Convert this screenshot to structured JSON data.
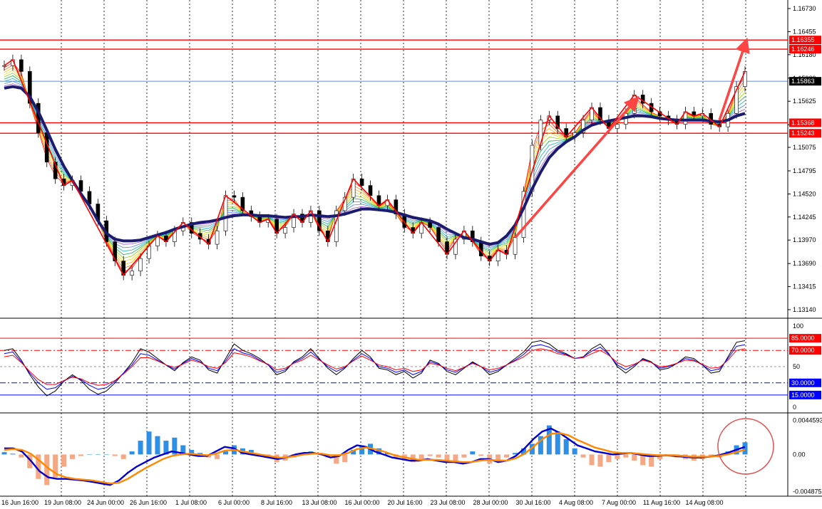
{
  "chart_data": [
    {
      "type": "line",
      "panel": "price",
      "y_ticks": [
        "1.16730",
        "1.16455",
        "1.16180",
        "1.15900",
        "1.15625",
        "1.15345",
        "1.15075",
        "1.14795",
        "1.14520",
        "1.14245",
        "1.13970",
        "1.13690",
        "1.13415",
        "1.13140"
      ],
      "ylim": [
        1.1314,
        1.1673
      ],
      "x_labels": [
        "16 Jun 16:00",
        "19 Jun 08:00",
        "24 Jun 00:00",
        "26 Jun 16:00",
        "1 Jul 08:00",
        "6 Jul 00:00",
        "8 Jul 16:00",
        "13 Jul 08:00",
        "16 Jul 00:00",
        "20 Jul 16:00",
        "23 Jul 08:00",
        "28 Jul 00:00",
        "30 Jul 16:00",
        "4 Aug 08:00",
        "7 Aug 00:00",
        "11 Aug 16:00",
        "14 Aug 08:00"
      ],
      "horizontal_levels": [
        {
          "value": 1.16355,
          "label": "1.16355",
          "color": "#ff0000"
        },
        {
          "value": 1.16246,
          "label": "1.16246",
          "color": "#ff0000"
        },
        {
          "value": 1.15863,
          "label": "1.15863",
          "color": "#000000"
        },
        {
          "value": 1.15368,
          "label": "1.15368",
          "color": "#ff0000"
        },
        {
          "value": 1.15243,
          "label": "1.15243",
          "color": "#ff0000"
        }
      ],
      "series": [
        {
          "role": "price",
          "values": [
            1.1605,
            1.1612,
            1.1598,
            1.156,
            1.1525,
            1.149,
            1.147,
            1.1462,
            1.1468,
            1.1455,
            1.144,
            1.142,
            1.1395,
            1.1372,
            1.1355,
            1.136,
            1.1375,
            1.139,
            1.1402,
            1.1395,
            1.1408,
            1.1418,
            1.1405,
            1.1398,
            1.1392,
            1.1408,
            1.145,
            1.1448,
            1.1432,
            1.1425,
            1.1418,
            1.1422,
            1.1405,
            1.1412,
            1.1428,
            1.1418,
            1.1432,
            1.1408,
            1.1395,
            1.1432,
            1.1448,
            1.147,
            1.1462,
            1.145,
            1.1438,
            1.1445,
            1.1428,
            1.1412,
            1.1405,
            1.1418,
            1.1412,
            1.1395,
            1.138,
            1.1398,
            1.1408,
            1.1395,
            1.1378,
            1.1372,
            1.1385,
            1.138,
            1.14,
            1.1455,
            1.151,
            1.154,
            1.1545,
            1.153,
            1.152,
            1.1525,
            1.154,
            1.1555,
            1.154,
            1.153,
            1.1535,
            1.1548,
            1.157,
            1.156,
            1.155,
            1.1545,
            1.154,
            1.1535,
            1.155,
            1.1545,
            1.1548,
            1.1535,
            1.1532,
            1.1548,
            1.158,
            1.1598
          ]
        },
        {
          "role": "moving-average",
          "color": "#1c1c6e",
          "values": [
            1.1578,
            1.158,
            1.1578,
            1.1568,
            1.155,
            1.1528,
            1.1505,
            1.1485,
            1.1468,
            1.1452,
            1.1438,
            1.142,
            1.1405,
            1.1398,
            1.1396,
            1.1396,
            1.1397,
            1.14,
            1.1403,
            1.1406,
            1.141,
            1.1413,
            1.1416,
            1.1418,
            1.1419,
            1.1421,
            1.1424,
            1.1426,
            1.1427,
            1.1427,
            1.1426,
            1.1426,
            1.1425,
            1.1424,
            1.1425,
            1.1425,
            1.1427,
            1.1426,
            1.1425,
            1.1426,
            1.1428,
            1.1431,
            1.1434,
            1.1434,
            1.1433,
            1.1432,
            1.143,
            1.1427,
            1.1424,
            1.1422,
            1.142,
            1.1416,
            1.141,
            1.1405,
            1.14,
            1.1398,
            1.1395,
            1.1392,
            1.1394,
            1.1402,
            1.1415,
            1.1435,
            1.1458,
            1.1478,
            1.1495,
            1.1506,
            1.1514,
            1.152,
            1.1528,
            1.1534,
            1.1537,
            1.1539,
            1.1541,
            1.1543,
            1.1545,
            1.1545,
            1.1544,
            1.1542,
            1.1541,
            1.154,
            1.154,
            1.154,
            1.154,
            1.1539,
            1.1538,
            1.154,
            1.1545,
            1.1548
          ]
        }
      ]
    },
    {
      "type": "line",
      "panel": "oscillator",
      "y_ticks": [
        "100",
        "50",
        "0"
      ],
      "ylim": [
        0,
        100
      ],
      "levels": [
        {
          "value": 85,
          "label": "85.0000",
          "color": "#ff0000"
        },
        {
          "value": 70,
          "label": "70.0000",
          "color": "#ff0000"
        },
        {
          "value": 30,
          "label": "30.0000",
          "color": "#0000ff"
        },
        {
          "value": 15,
          "label": "15.0000",
          "color": "#0000ff"
        }
      ],
      "series": [
        {
          "color": "#000000",
          "values": [
            70,
            72,
            58,
            40,
            25,
            14,
            20,
            32,
            40,
            33,
            22,
            16,
            20,
            30,
            42,
            55,
            72,
            68,
            60,
            52,
            45,
            55,
            62,
            58,
            46,
            42,
            60,
            78,
            70,
            66,
            60,
            52,
            40,
            44,
            56,
            62,
            72,
            60,
            48,
            40,
            48,
            60,
            70,
            62,
            48,
            46,
            40,
            44,
            36,
            42,
            58,
            54,
            44,
            40,
            48,
            56,
            50,
            40,
            44,
            52,
            60,
            68,
            80,
            82,
            78,
            70,
            66,
            60,
            62,
            72,
            78,
            66,
            50,
            42,
            50,
            60,
            56,
            46,
            48,
            54,
            62,
            60,
            52,
            42,
            44,
            62,
            80,
            82
          ]
        },
        {
          "color": "#0000ff",
          "values": [
            66,
            68,
            56,
            42,
            30,
            22,
            24,
            32,
            38,
            34,
            27,
            22,
            24,
            32,
            42,
            52,
            66,
            64,
            58,
            52,
            47,
            54,
            60,
            56,
            48,
            45,
            57,
            72,
            67,
            64,
            58,
            52,
            43,
            46,
            55,
            60,
            68,
            59,
            50,
            44,
            49,
            58,
            66,
            60,
            50,
            48,
            43,
            46,
            40,
            44,
            56,
            53,
            46,
            43,
            49,
            55,
            50,
            43,
            46,
            52,
            58,
            65,
            75,
            77,
            74,
            68,
            65,
            60,
            62,
            69,
            74,
            65,
            52,
            46,
            52,
            59,
            55,
            48,
            50,
            54,
            60,
            58,
            52,
            45,
            47,
            60,
            75,
            77
          ]
        },
        {
          "color": "#ff0000",
          "values": [
            62,
            64,
            55,
            44,
            34,
            28,
            28,
            33,
            37,
            35,
            30,
            27,
            28,
            33,
            41,
            50,
            61,
            61,
            57,
            52,
            49,
            53,
            58,
            55,
            50,
            48,
            55,
            67,
            65,
            62,
            57,
            53,
            46,
            48,
            54,
            58,
            64,
            58,
            52,
            47,
            50,
            57,
            63,
            58,
            52,
            50,
            46,
            48,
            44,
            46,
            54,
            52,
            48,
            45,
            49,
            54,
            50,
            46,
            48,
            52,
            57,
            62,
            70,
            72,
            70,
            66,
            64,
            60,
            61,
            66,
            70,
            64,
            55,
            50,
            53,
            58,
            55,
            50,
            51,
            54,
            58,
            57,
            53,
            48,
            49,
            58,
            70,
            72
          ]
        }
      ]
    },
    {
      "type": "bar",
      "panel": "macd",
      "y_ticks": [
        "0.0044593",
        "0.00",
        "-0.004875"
      ],
      "ylim": [
        -0.0049,
        0.0046
      ],
      "bars": [
        0.0003,
        0.0001,
        -0.0004,
        -0.0018,
        -0.0032,
        -0.004,
        -0.003,
        -0.0016,
        -0.0006,
        -0.0002,
        0,
        0,
        0,
        -0.0002,
        -0.0006,
        0.0004,
        0.0018,
        0.003,
        0.0024,
        0.0018,
        0.0022,
        0.0012,
        0.0006,
        0.0002,
        -0.0004,
        -0.0006,
        0.0004,
        0.0012,
        0.0008,
        0.0006,
        -0.0002,
        -0.0004,
        -0.001,
        -0.0008,
        -0.0004,
        0.0002,
        0.0004,
        0.0001,
        -0.0004,
        -0.0012,
        -0.001,
        0.0006,
        0.0012,
        0.0014,
        0.0008,
        0.0002,
        -0.0004,
        -0.0008,
        -0.001,
        -0.0006,
        -0.0002,
        -0.0004,
        -0.0008,
        -0.001,
        -0.0004,
        0.0004,
        -0.0002,
        -0.0012,
        -0.001,
        -0.0004,
        0.0002,
        0.0008,
        0.0014,
        0.0024,
        0.0038,
        0.003,
        0.002,
        0.0008,
        -0.0004,
        -0.0014,
        -0.0016,
        -0.001,
        -0.0006,
        -0.0004,
        -0.0008,
        -0.0014,
        -0.0016,
        -0.0006,
        -0.0002,
        -0.0004,
        -0.0006,
        -0.0008,
        -0.0006,
        -0.0004,
        -0.0004,
        0.0004,
        0.0012,
        0.0016
      ],
      "series": [
        {
          "color": "#0000cc",
          "values": [
            0.0008,
            0.0008,
            0.0004,
            -0.0008,
            -0.0022,
            -0.003,
            -0.0032,
            -0.0032,
            -0.0033,
            -0.0034,
            -0.0036,
            -0.0038,
            -0.004,
            -0.0034,
            -0.0024,
            -0.0016,
            -0.001,
            -0.0004,
            0.0,
            0.0004,
            0.0002,
            0.0,
            -0.0002,
            -0.0002,
            0.0004,
            0.001,
            0.0008,
            0.0002,
            0.0,
            -0.0002,
            -0.0004,
            -0.0006,
            -0.0004,
            0.0,
            0.0002,
            0.0002,
            0.0,
            -0.0004,
            -0.0002,
            0.0006,
            0.0012,
            0.001,
            0.0004,
            0.0,
            -0.0004,
            -0.0006,
            -0.0008,
            -0.0008,
            -0.0006,
            -0.0008,
            -0.001,
            -0.001,
            -0.0012,
            -0.001,
            -0.0006,
            -0.0006,
            -0.001,
            -0.0008,
            -0.0002,
            0.0008,
            0.002,
            0.003,
            0.0034,
            0.0028,
            0.002,
            0.0012,
            0.0008,
            0.0004,
            0.0002,
            0.0,
            0.0001,
            0.0002,
            0.0,
            -0.0002,
            -0.0002,
            -0.0001,
            -0.0002,
            -0.0003,
            -0.0004,
            -0.0004,
            -0.0003,
            -0.0001,
            0.0002,
            0.0006,
            0.001
          ]
        },
        {
          "color": "#ff8800",
          "values": [
            0.0006,
            0.0007,
            0.0006,
            0.0001,
            -0.0008,
            -0.0018,
            -0.0026,
            -0.003,
            -0.0032,
            -0.0033,
            -0.0034,
            -0.0036,
            -0.0038,
            -0.0037,
            -0.0032,
            -0.0025,
            -0.0018,
            -0.0012,
            -0.0006,
            -0.0002,
            0.0,
            0.0001,
            0.0,
            -0.0001,
            0.0001,
            0.0005,
            0.0006,
            0.0004,
            0.0002,
            0.0,
            -0.0002,
            -0.0004,
            -0.0004,
            -0.0002,
            0.0,
            0.0001,
            0.0001,
            -0.0001,
            -0.0001,
            0.0002,
            0.0007,
            0.0009,
            0.0007,
            0.0004,
            0.0,
            -0.0003,
            -0.0005,
            -0.0007,
            -0.0007,
            -0.0007,
            -0.0008,
            -0.0009,
            -0.001,
            -0.001,
            -0.0008,
            -0.0007,
            -0.0008,
            -0.0008,
            -0.0005,
            0.0001,
            0.001,
            0.002,
            0.0027,
            0.0028,
            0.0025,
            0.0019,
            0.0014,
            0.0009,
            0.0006,
            0.0003,
            0.0002,
            0.0002,
            0.0001,
            0.0,
            -0.0001,
            -0.0001,
            -0.0001,
            -0.0002,
            -0.0003,
            -0.0003,
            -0.0003,
            -0.0002,
            0.0,
            0.0003,
            0.0006
          ]
        }
      ]
    }
  ]
}
